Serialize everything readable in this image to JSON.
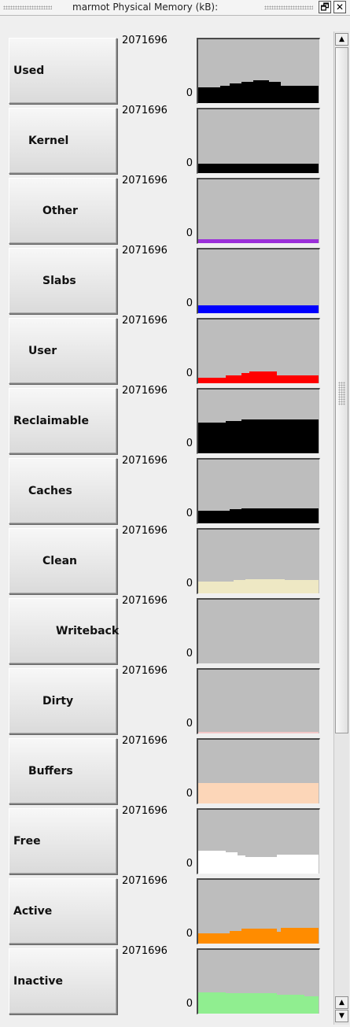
{
  "window": {
    "title": "marmot Physical Memory (kB):",
    "restore_icon": "restore-icon",
    "close_icon": "close-icon"
  },
  "rows": [
    {
      "label": "Used",
      "max": "2071696",
      "zero": "0",
      "color": "#000000"
    },
    {
      "label": "Kernel",
      "max": "2071696",
      "zero": "0",
      "color": "#000000"
    },
    {
      "label": "Other",
      "max": "2071696",
      "zero": "0",
      "color": "#9b30d9"
    },
    {
      "label": "Slabs",
      "max": "2071696",
      "zero": "0",
      "color": "#0000ff"
    },
    {
      "label": "User",
      "max": "2071696",
      "zero": "0",
      "color": "#ff0000"
    },
    {
      "label": "Reclaimable",
      "max": "2071696",
      "zero": "0",
      "color": "#000000"
    },
    {
      "label": "Caches",
      "max": "2071696",
      "zero": "0",
      "color": "#000000"
    },
    {
      "label": "Clean",
      "max": "2071696",
      "zero": "0",
      "color": "#eee8c4"
    },
    {
      "label": "Writeback",
      "max": "2071696",
      "zero": "0",
      "color": "#bdbdbd"
    },
    {
      "label": "Dirty",
      "max": "2071696",
      "zero": "0",
      "color": "#f2c8c8"
    },
    {
      "label": "Buffers",
      "max": "2071696",
      "zero": "0",
      "color": "#fcd6b8"
    },
    {
      "label": "Free",
      "max": "2071696",
      "zero": "0",
      "color": "#ffffff"
    },
    {
      "label": "Active",
      "max": "2071696",
      "zero": "0",
      "color": "#ff8c00"
    },
    {
      "label": "Inactive",
      "max": "2071696",
      "zero": "0",
      "color": "#90ee90"
    }
  ],
  "scrollbar": {
    "up_icon": "arrow-up-icon",
    "down_icon": "arrow-down-icon"
  }
}
